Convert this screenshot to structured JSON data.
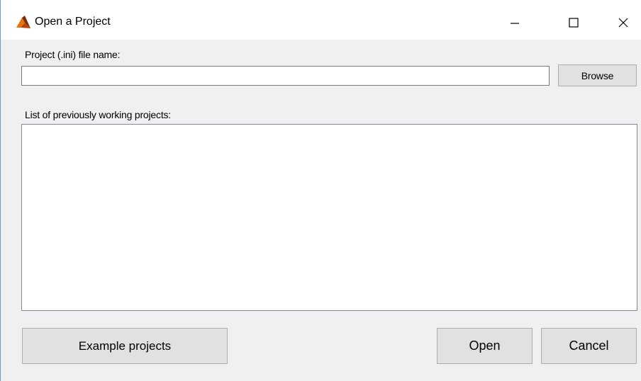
{
  "window": {
    "title": "Open a Project",
    "app_icon": "matlab-peak-icon",
    "accent_colors": {
      "icon_orange": "#e8720c",
      "icon_dark": "#7a2e0a",
      "border_blue": "#6a9bd8"
    },
    "controls": {
      "minimize_icon": "minimize-icon",
      "maximize_icon": "maximize-icon",
      "close_icon": "close-icon"
    }
  },
  "form": {
    "project_file_label": "Project (.ini) file name:",
    "project_file_value": "",
    "browse_label": "Browse",
    "previous_projects_label": "List of previously working projects:",
    "previous_projects": []
  },
  "footer": {
    "example_projects_label": "Example projects",
    "open_label": "Open",
    "cancel_label": "Cancel"
  }
}
